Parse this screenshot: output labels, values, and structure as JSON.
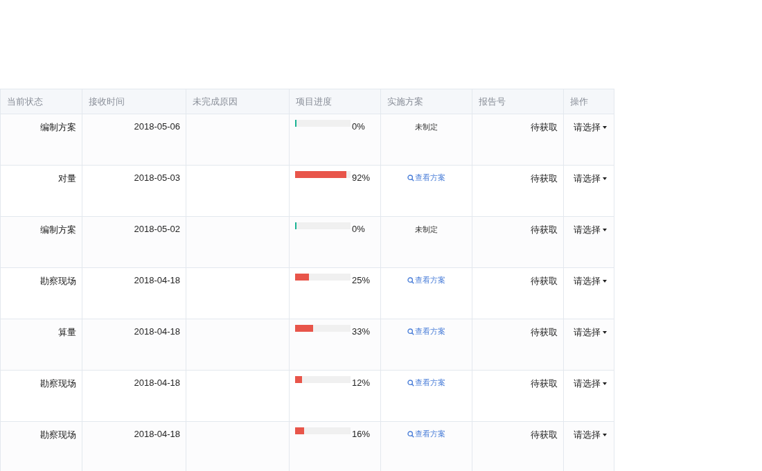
{
  "table": {
    "columns": [
      "当前状态",
      "接收时间",
      "未完成原因",
      "项目进度",
      "实施方案",
      "报告号",
      "操作"
    ],
    "rows": [
      {
        "status": "编制方案",
        "received": "2018-05-06",
        "level": 0,
        "percent": "0%",
        "plan": {
          "kind": "none",
          "text": "未制定"
        },
        "report": "待获取",
        "action": "请选择"
      },
      {
        "status": "对量",
        "received": "2018-05-03",
        "level": 0.92,
        "percent": "92%",
        "plan": {
          "kind": "link",
          "text": "查看方案"
        },
        "report": "待获取",
        "action": "请选择"
      },
      {
        "status": "编制方案",
        "received": "2018-05-02",
        "level": 0,
        "percent": "0%",
        "plan": {
          "kind": "none",
          "text": "未制定"
        },
        "report": "待获取",
        "action": "请选择"
      },
      {
        "status": "勘察现场",
        "received": "2018-04-18",
        "level": 0.25,
        "percent": "25%",
        "plan": {
          "kind": "link",
          "text": "查看方案"
        },
        "report": "待获取",
        "action": "请选择"
      },
      {
        "status": "算量",
        "received": "2018-04-18",
        "level": 0.33,
        "percent": "33%",
        "plan": {
          "kind": "link",
          "text": "查看方案"
        },
        "report": "待获取",
        "action": "请选择"
      },
      {
        "status": "勘察现场",
        "received": "2018-04-18",
        "level": 0.12,
        "percent": "12%",
        "plan": {
          "kind": "link",
          "text": "查看方案"
        },
        "report": "待获取",
        "action": "请选择"
      },
      {
        "status": "勘察现场",
        "received": "2018-04-18",
        "level": 0.16,
        "percent": "16%",
        "plan": {
          "kind": "link",
          "text": "查看方案"
        },
        "report": "待获取",
        "action": "请选择"
      }
    ]
  }
}
